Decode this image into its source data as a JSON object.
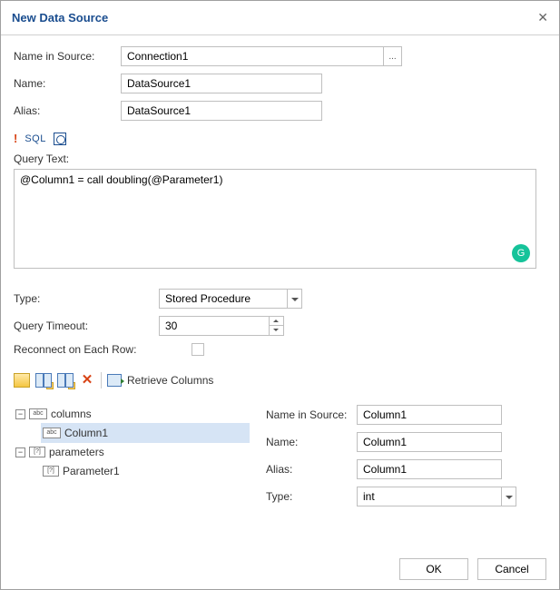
{
  "title": "New Data Source",
  "form": {
    "name_in_source_label": "Name in Source:",
    "name_in_source_value": "Connection1",
    "browse_label": "...",
    "name_label": "Name:",
    "name_value": "DataSource1",
    "alias_label": "Alias:",
    "alias_value": "DataSource1"
  },
  "sql": {
    "warn": "!",
    "label": "SQL"
  },
  "query": {
    "label": "Query Text:",
    "value": "@Column1 = call doubling(@Parameter1)"
  },
  "mid": {
    "type_label": "Type:",
    "type_value": "Stored Procedure",
    "timeout_label": "Query Timeout:",
    "timeout_value": "30",
    "reconnect_label": "Reconnect on Each Row:"
  },
  "toolbar": {
    "retrieve": "Retrieve Columns"
  },
  "tree": {
    "columns_label": "columns",
    "column1_label": "Column1",
    "parameters_label": "parameters",
    "parameter1_label": "Parameter1"
  },
  "colform": {
    "name_in_source_label": "Name in Source:",
    "name_in_source_value": "Column1",
    "name_label": "Name:",
    "name_value": "Column1",
    "alias_label": "Alias:",
    "alias_value": "Column1",
    "type_label": "Type:",
    "type_value": "int"
  },
  "buttons": {
    "ok": "OK",
    "cancel": "Cancel"
  },
  "grammarly_glyph": "G"
}
